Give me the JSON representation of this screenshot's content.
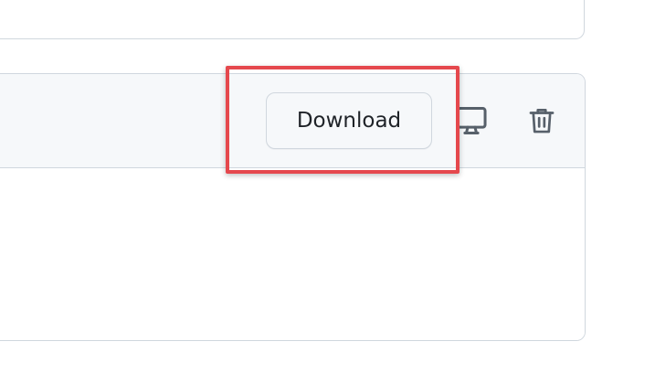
{
  "card": {
    "download_label": "Download"
  },
  "icons": {
    "monitor": "monitor-icon",
    "trash": "trash-icon"
  },
  "colors": {
    "border": "#d0d7de",
    "header_bg": "#f6f8fa",
    "text": "#1f2328",
    "icon": "#57606a",
    "highlight": "#e5484d"
  }
}
